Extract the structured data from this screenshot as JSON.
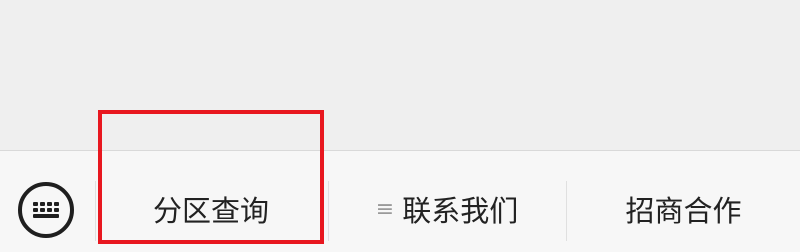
{
  "bottom_menu": {
    "keyboard_icon": "keyboard-icon",
    "items": [
      {
        "label": "分区查询",
        "icon": ""
      },
      {
        "label": "联系我们",
        "icon": "≡"
      },
      {
        "label": "招商合作",
        "icon": ""
      }
    ]
  },
  "annotation": {
    "highlight_color": "#e8171f"
  },
  "colors": {
    "content_background": "#efefef",
    "menu_background": "#f7f7f7",
    "text": "#222222"
  }
}
